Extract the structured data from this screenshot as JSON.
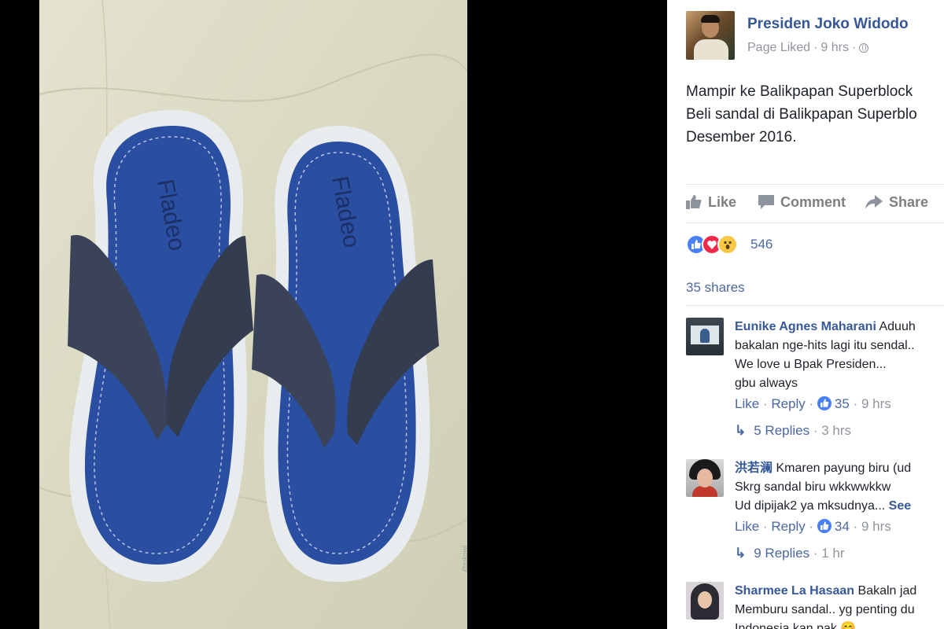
{
  "photo": {
    "watermark": "@jokowi",
    "brand_left": "Fladeo",
    "brand_right": "Fladeo"
  },
  "post": {
    "page_name": "Presiden Joko Widodo",
    "meta_status": "Page Liked",
    "meta_time": "9 hrs",
    "text_lines": [
      "Mampir ke Balikpapan Superblock",
      "Beli sandal di Balikpapan Superblo",
      "Desember 2016."
    ]
  },
  "actions": {
    "like": "Like",
    "comment": "Comment",
    "share": "Share"
  },
  "reactions": {
    "count": "546",
    "icons": [
      "like-icon",
      "love-icon",
      "wow-icon"
    ]
  },
  "shares": "35 shares",
  "comments": [
    {
      "name": "Eunike Agnes Maharani",
      "first_line_rest": "Aduuh",
      "lines": [
        "bakalan nge-hits lagi itu sendal..",
        "We love u Bpak Presiden...",
        "gbu always"
      ],
      "like": "Like",
      "reply": "Reply",
      "likes": "35",
      "time": "9 hrs",
      "replies": "5 Replies",
      "replies_time": "3 hrs"
    },
    {
      "name": "洪若澜",
      "first_line_rest": "Kmaren payung biru (ud",
      "lines": [
        "Skrg sandal biru wkkwwkkw",
        "Ud dipijak2 ya mksudnya..."
      ],
      "see_more": "See",
      "like": "Like",
      "reply": "Reply",
      "likes": "34",
      "time": "9 hrs",
      "replies": "9 Replies",
      "replies_time": "1 hr"
    },
    {
      "name": "Sharmee La Hasaan",
      "first_line_rest": "Bakaln jad",
      "lines": [
        "Memburu sandal.. yg penting du",
        "Indonesia kan pak 😊"
      ]
    }
  ],
  "colors": {
    "link": "#365899",
    "accent": "#4a80f5",
    "sole": "#2a4ea0"
  }
}
